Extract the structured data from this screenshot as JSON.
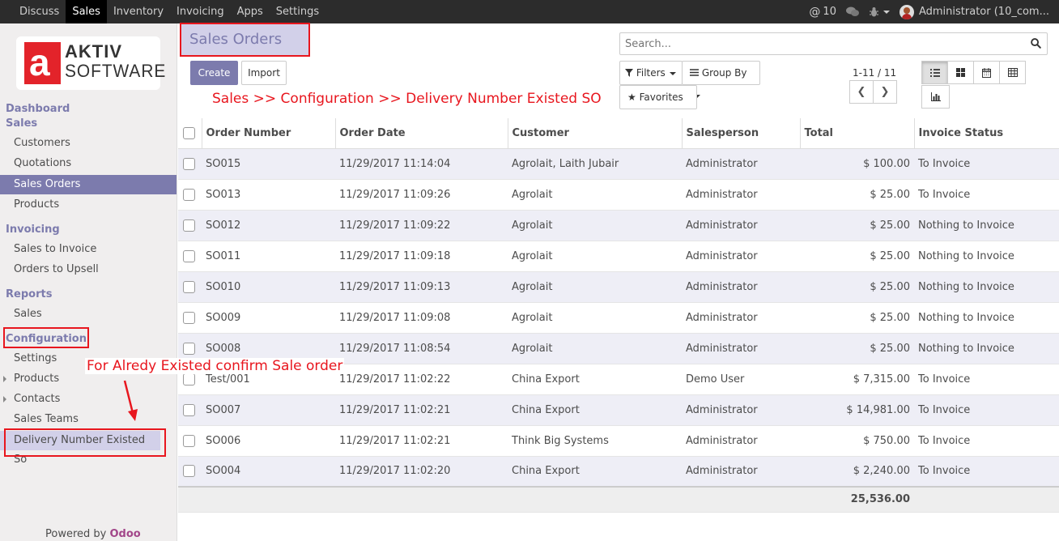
{
  "topbar": {
    "menu": [
      "Discuss",
      "Sales",
      "Inventory",
      "Invoicing",
      "Apps",
      "Settings"
    ],
    "active": "Sales",
    "mentions": "10",
    "user": "Administrator (10_com..."
  },
  "logo": {
    "mark": "a",
    "line1": "AKTIV",
    "line2": "SOFTWARE"
  },
  "sidebar": {
    "dashboard": "Dashboard",
    "sales_header": "Sales",
    "sales_items": [
      "Customers",
      "Quotations",
      "Sales Orders",
      "Products"
    ],
    "invoicing_header": "Invoicing",
    "invoicing_items": [
      "Sales to Invoice",
      "Orders to Upsell"
    ],
    "reports_header": "Reports",
    "reports_items": [
      "Sales"
    ],
    "configuration_header": "Configuration",
    "configuration_items": [
      "Settings",
      "Products",
      "Contacts",
      "Sales Teams",
      "Delivery Number Existed So"
    ],
    "powered_by": "Powered by",
    "powered_brand": "Odoo"
  },
  "control": {
    "title": "Sales Orders",
    "create": "Create",
    "import": "Import",
    "search_placeholder": "Search...",
    "filters": "Filters",
    "group_by": "Group By",
    "favorites": "Favorites",
    "pager": "1-11 / 11"
  },
  "annotations": {
    "path_note": "Sales >> Configuration >> Delivery Number Existed SO",
    "menu_note": "For Alredy Existed confirm Sale order"
  },
  "table": {
    "columns": [
      "Order Number",
      "Order Date",
      "Customer",
      "Salesperson",
      "Total",
      "Invoice Status"
    ],
    "rows": [
      [
        "SO015",
        "11/29/2017 11:14:04",
        "Agrolait, Laith Jubair",
        "Administrator",
        "$ 100.00",
        "To Invoice"
      ],
      [
        "SO013",
        "11/29/2017 11:09:26",
        "Agrolait",
        "Administrator",
        "$ 25.00",
        "To Invoice"
      ],
      [
        "SO012",
        "11/29/2017 11:09:22",
        "Agrolait",
        "Administrator",
        "$ 25.00",
        "Nothing to Invoice"
      ],
      [
        "SO011",
        "11/29/2017 11:09:18",
        "Agrolait",
        "Administrator",
        "$ 25.00",
        "Nothing to Invoice"
      ],
      [
        "SO010",
        "11/29/2017 11:09:13",
        "Agrolait",
        "Administrator",
        "$ 25.00",
        "Nothing to Invoice"
      ],
      [
        "SO009",
        "11/29/2017 11:09:08",
        "Agrolait",
        "Administrator",
        "$ 25.00",
        "Nothing to Invoice"
      ],
      [
        "SO008",
        "11/29/2017 11:08:54",
        "Agrolait",
        "Administrator",
        "$ 25.00",
        "Nothing to Invoice"
      ],
      [
        "Test/001",
        "11/29/2017 11:02:22",
        "China Export",
        "Demo User",
        "$ 7,315.00",
        "To Invoice"
      ],
      [
        "SO007",
        "11/29/2017 11:02:21",
        "China Export",
        "Administrator",
        "$ 14,981.00",
        "To Invoice"
      ],
      [
        "SO006",
        "11/29/2017 11:02:21",
        "Think Big Systems",
        "Administrator",
        "$ 750.00",
        "To Invoice"
      ],
      [
        "SO004",
        "11/29/2017 11:02:20",
        "China Export",
        "Administrator",
        "$ 2,240.00",
        "To Invoice"
      ]
    ],
    "total": "25,536.00"
  },
  "colors": {
    "accent": "#7c7bad",
    "highlight": "#e8161e",
    "topbar": "#2c2c2c"
  }
}
